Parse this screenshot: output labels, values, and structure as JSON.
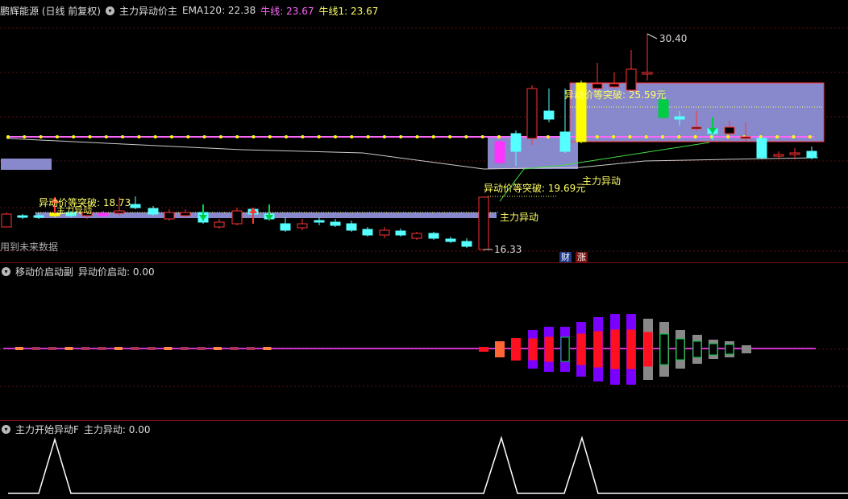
{
  "main": {
    "title": "鹏辉能源 (日线 前复权)",
    "indicator": "主力异动价主",
    "ema": "EMA120: 22.38",
    "niu": "牛线: 23.67",
    "niu1": "牛线1: 23.67",
    "high_label": "30.40",
    "low_label": "16.33",
    "future_label": "用到未来数据",
    "breakout1": "异动价等突破: 18.73",
    "breakout2": "异动价等突破: 19.69元",
    "breakout3": "异动价等突破: 25.59元",
    "zhuli1": "主力异动",
    "zhuli2": "主力异动",
    "zhuli3": "主力异动",
    "badge_cai": "财",
    "badge_zhang": "涨"
  },
  "panel2": {
    "title": "移动价启动副",
    "value": "异动价启动: 0.00"
  },
  "panel3": {
    "title": "主力开始异动F",
    "value": "主力异动: 0.00"
  },
  "colors": {
    "up": "#ff3333",
    "down": "#54ffff",
    "ema": "#cccccc",
    "niu": "#ff66ff",
    "dots": "#ffff00",
    "box": "#8888cc",
    "sep": "#7a1010",
    "purple": "#7a00ff",
    "red": "#ff1020",
    "gray": "#888888",
    "green": "#00cc44",
    "yellow": "#ffff00",
    "magenta": "#ff33ff"
  }
}
